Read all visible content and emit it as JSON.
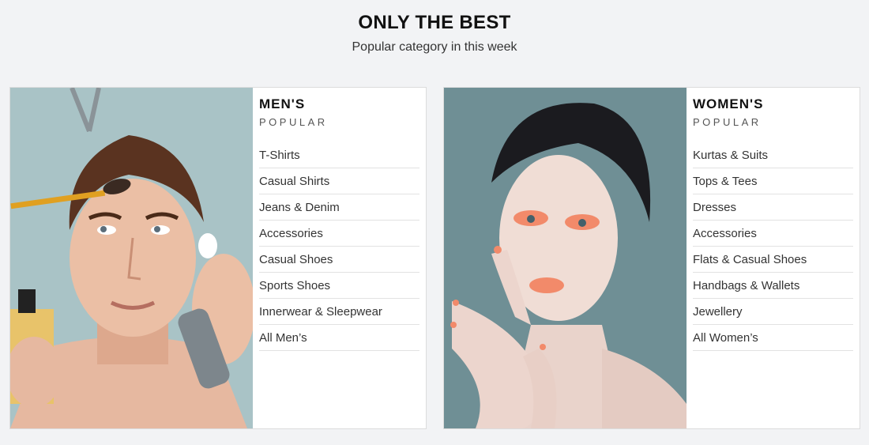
{
  "section": {
    "title": "ONLY THE BEST",
    "subtitle": "Popular category in this week"
  },
  "men": {
    "title": "MEN'S",
    "subtitle": "POPULAR",
    "items": [
      "T-Shirts",
      "Casual Shirts",
      "Jeans & Denim",
      "Accessories",
      "Casual Shoes",
      "Sports Shoes",
      "Innerwear & Sleepwear",
      "All Men’s"
    ]
  },
  "women": {
    "title": "WOMEN'S",
    "subtitle": "POPULAR",
    "items": [
      "Kurtas & Suits",
      "Tops & Tees",
      "Dresses",
      "Accessories",
      "Flats & Casual Shoes",
      "Handbags & Wallets",
      "Jewellery",
      "All Women’s"
    ]
  },
  "colors": {
    "page_bg": "#f2f3f5",
    "men_photo_bg": "#a9c3c6",
    "women_photo_bg": "#6f8f95"
  }
}
